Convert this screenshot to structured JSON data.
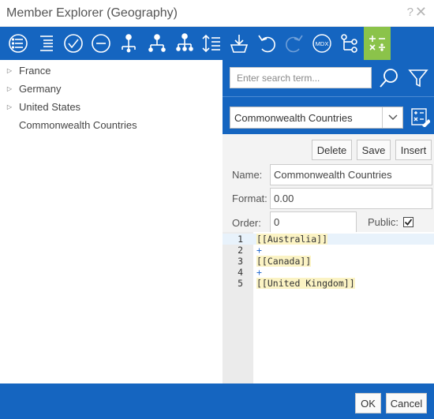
{
  "window": {
    "title": "Member Explorer (Geography)",
    "help_glyph": "?",
    "close_glyph": "✕"
  },
  "toolbar": {
    "buttons": [
      {
        "icon": "list-circle-icon"
      },
      {
        "icon": "list-lines-icon"
      },
      {
        "icon": "check-circle-icon"
      },
      {
        "icon": "minus-circle-icon"
      },
      {
        "icon": "hierarchy-down-icon"
      },
      {
        "icon": "hierarchy-children-icon"
      },
      {
        "icon": "hierarchy-descendants-icon"
      },
      {
        "icon": "sort-icon"
      },
      {
        "icon": "download-basket-icon"
      },
      {
        "icon": "undo-icon"
      },
      {
        "icon": "redo-icon"
      },
      {
        "icon": "mdx-icon",
        "text": "MDX"
      },
      {
        "icon": "tree-connect-icon"
      },
      {
        "icon": "calculator-icon"
      }
    ],
    "active_index": 13
  },
  "tree": {
    "items": [
      {
        "label": "France",
        "expandable": true
      },
      {
        "label": "Germany",
        "expandable": true
      },
      {
        "label": "United States",
        "expandable": true
      },
      {
        "label": "Commonwealth Countries",
        "expandable": false
      }
    ]
  },
  "search": {
    "placeholder": "Enter search term..."
  },
  "set_select": {
    "value": "Commonwealth Countries"
  },
  "actions": {
    "delete": "Delete",
    "save": "Save",
    "insert": "Insert"
  },
  "form": {
    "name_label": "Name:",
    "name_value": "Commonwealth Countries",
    "format_label": "Format:",
    "format_value": "0.00",
    "order_label": "Order:",
    "order_value": "0",
    "public_label": "Public:",
    "public_checked": true
  },
  "editor": {
    "lines": [
      {
        "num": "1",
        "text": "[[Australia]]",
        "type": "member"
      },
      {
        "num": "2",
        "text": "+",
        "type": "op"
      },
      {
        "num": "3",
        "text": "[[Canada]]",
        "type": "member"
      },
      {
        "num": "4",
        "text": "+",
        "type": "op"
      },
      {
        "num": "5",
        "text": "[[United Kingdom]]",
        "type": "member"
      }
    ]
  },
  "footer": {
    "ok": "OK",
    "cancel": "Cancel"
  },
  "colors": {
    "accent": "#1565c0",
    "active": "#8bc34a",
    "highlight": "#fbf3c4"
  }
}
